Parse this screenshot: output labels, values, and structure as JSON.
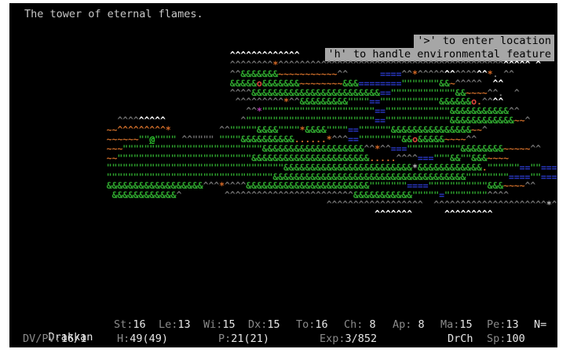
{
  "message": "The tower of eternal flames.",
  "hints": [
    "'>' to enter location",
    "'h' to handle environmental feature"
  ],
  "status": {
    "name": "Drakkan",
    "st_label": "St:",
    "st": "16",
    "le_label": "Le:",
    "le": "13",
    "wi_label": "Wi:",
    "wi": "15",
    "dx_label": "Dx:",
    "dx": "15",
    "to_label": "To:",
    "to": "16",
    "ch_label": "Ch:",
    "ch": " 8",
    "ap_label": "Ap:",
    "ap": " 8",
    "ma_label": "Ma:",
    "ma": "15",
    "pe_label": "Pe:",
    "pe": "13",
    "n_label": "N=",
    "dvpv_label": "DV/PV:",
    "dvpv": "16/1",
    "h_label": "H:",
    "h": "49(49)",
    "p_label": "P:",
    "p": "21(21)",
    "exp_label": "Exp:",
    "exp": "3/852",
    "class": "DrCh",
    "sp_label": "Sp:",
    "sp": "100"
  },
  "map_rows": [
    [
      [
        "m",
        "                         "
      ],
      [
        "w",
        "^^^^^^^^^^^^^"
      ]
    ],
    [
      [
        "m",
        "                         ^^^^^^^^"
      ],
      [
        "o",
        "*"
      ],
      [
        "m",
        "^^^^^^^^^^^^^^^^^^^^^^^^^^^^^^^^^^^^^^^^^^"
      ],
      [
        "w",
        "^^^^^ ^   ^^^  ^"
      ]
    ],
    [
      [
        "m",
        "                         ^^"
      ],
      [
        "g",
        "&&&&&&&"
      ],
      [
        "h",
        "~~~~~~~~~~~"
      ],
      [
        "m",
        "^^      "
      ],
      [
        "b",
        "===="
      ],
      [
        "m",
        "^^"
      ],
      [
        "o",
        "*"
      ],
      [
        "m",
        "^^^^^"
      ],
      [
        "w",
        "^^"
      ],
      [
        "m",
        "^^^^"
      ],
      [
        "w",
        "^^"
      ],
      [
        "o",
        "*"
      ],
      [
        "m",
        ". ^^"
      ]
    ],
    [
      [
        "g",
        "                         &&&&&"
      ],
      [
        "r",
        "o"
      ],
      [
        "g",
        "&&&&&&&"
      ],
      [
        "h",
        "~~~~~~~~"
      ],
      [
        "g",
        "&&&"
      ],
      [
        "b",
        "========"
      ],
      [
        "g",
        "\"\"\"\"\"\"\"&&"
      ],
      [
        "h",
        "~"
      ],
      [
        "m",
        "^^^^^  "
      ],
      [
        "w",
        "^^"
      ]
    ],
    [
      [
        "m",
        "                         ^^^^"
      ],
      [
        "g",
        "&&&&&&&&&&&&&&&&&&&&&&&&"
      ],
      [
        "b",
        "=="
      ],
      [
        "g",
        "\"\"\"\"\"\"\"\"\"\"\"\"&&"
      ],
      [
        "h",
        "~~~~"
      ],
      [
        "m",
        "^^.  ^"
      ]
    ],
    [
      [
        "m",
        "                          ^^^^^^^^^"
      ],
      [
        "o",
        "*"
      ],
      [
        "m",
        "^^"
      ],
      [
        "g",
        "&&&&&&&&&\"\"\"\""
      ],
      [
        "b",
        "=="
      ],
      [
        "g",
        "\"\"\"\"\"\"\"\"\"\"\"&&&&&&"
      ],
      [
        "r",
        "o"
      ],
      [
        "h",
        "."
      ],
      [
        "m",
        "^^"
      ],
      [
        "w",
        "^^"
      ]
    ],
    [
      [
        "m",
        "                            ^^"
      ],
      [
        "p",
        "*"
      ],
      [
        "g",
        "\"\"\"\"\"\"\"\"\"\"\"\"\"\"\"\"\"\"\"\"\""
      ],
      [
        "b",
        "=="
      ],
      [
        "g",
        "\"\"\"\"\"\"\"\"\"\"\"\"&&&&&&&&&&&"
      ],
      [
        "m",
        "^^"
      ]
    ],
    [
      [
        "m",
        "    ^^^^"
      ],
      [
        "w",
        "^^^^^"
      ],
      [
        "m",
        "              ^"
      ],
      [
        "g",
        "\"\"\"\"\"\"\"\"\"\"\"\"\"\"\"\"\"\"\"\"\"\"\"\""
      ],
      [
        "b",
        "=="
      ],
      [
        "g",
        "\"\"\"\"\"\"\"\"\"\"\"\"&&&&&&&&&&&&"
      ],
      [
        "h",
        "~~"
      ],
      [
        "m",
        "^"
      ]
    ],
    [
      [
        "h",
        "  ~~^^^^^^^^^"
      ],
      [
        "o",
        "*"
      ],
      [
        "m",
        "         ^^"
      ],
      [
        "g",
        "\"\"\"\"\"&&&&\"\"\"\""
      ],
      [
        "o",
        "*"
      ],
      [
        "g",
        "&&&&\"\"\"\""
      ],
      [
        "b",
        "=="
      ],
      [
        "g",
        "\"\"\"\"\"\"&&&&&&&&&&&&&&&"
      ],
      [
        "h",
        "~~"
      ],
      [
        "m",
        "^"
      ]
    ],
    [
      [
        "h",
        "  ~~~~~~"
      ],
      [
        "g",
        "\"\""
      ],
      [
        "pl",
        "@"
      ],
      [
        "g",
        "\"\"\"\""
      ],
      [
        "m",
        " ^^\"\"\"\" "
      ],
      [
        "g",
        "\"\"\"\"&&&&&&&&&&"
      ],
      [
        "h",
        "......"
      ],
      [
        "o",
        "*"
      ],
      [
        "m",
        "^^^"
      ],
      [
        "b",
        "=="
      ],
      [
        "g",
        "\"\"\"\"\"\"\"\"&&"
      ],
      [
        "r",
        "o"
      ],
      [
        "g",
        "&&&&&"
      ],
      [
        "h",
        "~~~~"
      ],
      [
        "m",
        "^^"
      ]
    ],
    [
      [
        "h",
        "  ~~~"
      ],
      [
        "g",
        "\"\"\"\"\"\"\"\"\"\"\"\"\"\"\"\"\"\"\"\"\"\"\"\"\"\"&&&&&&&&&&&&&&&&&&&"
      ],
      [
        "m",
        "^^"
      ],
      [
        "o",
        "*"
      ],
      [
        "m",
        "^^"
      ],
      [
        "b",
        "==="
      ],
      [
        "g",
        "\"\"\"\"\"\"\"\"\"\"&&&&&&&&"
      ],
      [
        "h",
        "~~~~~"
      ],
      [
        "m",
        "^^"
      ]
    ],
    [
      [
        "h",
        "  ~~"
      ],
      [
        "g",
        "\"\"\"\"\"\"\"\"\"\"\"\"\"\"\"\"\"\"\"\"\"\"\"\"\"&&&&&&&&&&&&&&&&&&&&&&"
      ],
      [
        "h",
        "....."
      ],
      [
        "m",
        "^^^^"
      ],
      [
        "b",
        "==="
      ],
      [
        "g",
        "\"\"\"&&\"\"&&&"
      ],
      [
        "h",
        "~~~~"
      ]
    ],
    [
      [
        "g",
        "  \"\"\"\"\"\"\"\"\"\"\"\"\"\"\"\"\"\"\"\"\"\"\"\"\"\"\"\"\"\"\"\"\"&&&&&&&&&&&&&&&&&&&&&&&&"
      ],
      [
        "s",
        "*"
      ],
      [
        "g",
        "&&&&&&&&&&&&"
      ],
      [
        "h",
        "."
      ],
      [
        "g",
        "\"\"\"\"\"\""
      ],
      [
        "b",
        "=="
      ],
      [
        "g",
        "\"\""
      ],
      [
        "b",
        "===="
      ],
      [
        "g",
        "\"\"\"\""
      ],
      [
        "h",
        "~~~~~~"
      ],
      [
        "m",
        "^"
      ]
    ],
    [
      [
        "g",
        "  \"\"\"\"\"\"\"\"\"\"\"\"\"\"\"\"\"\"\"\"\"\"\"\"\"\"\"\"\"\"\"&&&&&&&&&&&&&&&&&&&&&&&&&&&&&&&&&&&&\"\"\"\"\"\"\"\""
      ],
      [
        "b",
        "===="
      ],
      [
        "g",
        "\"\""
      ],
      [
        "b",
        "===="
      ],
      [
        "g",
        "\"\"\""
      ],
      [
        "h",
        "~~~~"
      ],
      [
        "o",
        "*"
      ],
      [
        "m",
        "^"
      ]
    ],
    [
      [
        "g",
        "  &&&&&&&&&&&&&&&&&&"
      ],
      [
        "m",
        "^^^"
      ],
      [
        "o",
        "*"
      ],
      [
        "m",
        "^^^^"
      ],
      [
        "g",
        "&&&&&&&&&&&&&&&&&&&&&&&\"\"\"\"\"\"\""
      ],
      [
        "b",
        "===="
      ],
      [
        "g",
        "\"\"\"\"\"\"\"\"\"\"\"&&&"
      ],
      [
        "h",
        "~~~~"
      ],
      [
        "m",
        "^^"
      ]
    ],
    [
      [
        "g",
        "   &&&&&&&&&&&&"
      ],
      [
        "m",
        "^        ^^^^^^^^^^^^^^^^^^^^^^^^"
      ],
      [
        "g",
        "&&&&&&&&&&&\"\"\"\"\""
      ],
      [
        "b",
        "="
      ],
      [
        "g",
        "\"\"\"\"\"\"\"\""
      ],
      [
        "m",
        "^^^^"
      ]
    ],
    [
      [
        "m",
        "                                           ^^^^^^^^^^^^^^^^^^  ^^^^^^^^^^^^^^^^^^^^^"
      ],
      [
        "s",
        "*"
      ],
      [
        "m",
        "^"
      ]
    ],
    [
      [
        "w",
        "                                                    ^^^^^^^      ^^^^^^^^^"
      ]
    ]
  ]
}
